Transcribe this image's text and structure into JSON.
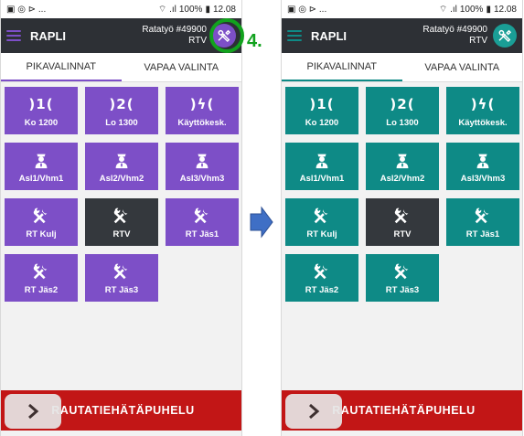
{
  "colors": {
    "purple": "#7d4fc7",
    "teal": "#0e8a86",
    "dark_tile": "#34383d",
    "appbar": "#2d3035",
    "emergency": "#c21616",
    "green_highlight": "#12a21e",
    "arrow_blue": "#3f6fc5",
    "teal_avatar": "#1a9e96"
  },
  "left": {
    "status": {
      "icons": "▣ ◎ ⊳ ...",
      "signal": "⌔ .ıl",
      "battery": "100%",
      "time": "12.08"
    },
    "appbar": {
      "title": "RAPLI",
      "work": "Ratatyö #49900",
      "role": "RTV"
    },
    "tabs": [
      "PIKAVALINNAT",
      "VAPAA VALINTA"
    ],
    "tiles": [
      {
        "label": "Ko 1200",
        "icon": "radio",
        "symbol": ")1("
      },
      {
        "label": "Lo 1300",
        "icon": "radio",
        "symbol": ")2("
      },
      {
        "label": "Käyttökesk.",
        "icon": "radio",
        "symbol": ")ϟ("
      },
      {
        "label": "Asl1/Vhm1",
        "icon": "person-icon"
      },
      {
        "label": "Asl2/Vhm2",
        "icon": "person-icon"
      },
      {
        "label": "Asl3/Vhm3",
        "icon": "person-icon"
      },
      {
        "label": "RT Kulj",
        "icon": "tools-icon"
      },
      {
        "label": "RTV",
        "icon": "tools-icon",
        "selected": true
      },
      {
        "label": "RT Jäs1",
        "icon": "tools-icon"
      },
      {
        "label": "RT Jäs2",
        "icon": "tools-icon"
      },
      {
        "label": "RT Jäs3",
        "icon": "tools-icon"
      }
    ],
    "bottom_label": "RAUTATIEHÄTÄPUHELU"
  },
  "right": {
    "status": {
      "icons": "▣ ◎ ⊳ ...",
      "signal": "⌔ .ıl",
      "battery": "100%",
      "time": "12.08"
    },
    "appbar": {
      "title": "RAPLI",
      "work": "Ratatyö #49900",
      "role": "RTV"
    },
    "tabs": [
      "PIKAVALINNAT",
      "VAPAA VALINTA"
    ],
    "tiles": [
      {
        "label": "Ko 1200",
        "icon": "radio",
        "symbol": ")1("
      },
      {
        "label": "Lo 1300",
        "icon": "radio",
        "symbol": ")2("
      },
      {
        "label": "Käyttökesk.",
        "icon": "radio",
        "symbol": ")ϟ("
      },
      {
        "label": "Asl1/Vhm1",
        "icon": "person-icon"
      },
      {
        "label": "Asl2/Vhm2",
        "icon": "person-icon"
      },
      {
        "label": "Asl3/Vhm3",
        "icon": "person-icon"
      },
      {
        "label": "RT Kulj",
        "icon": "tools-icon"
      },
      {
        "label": "RTV",
        "icon": "tools-icon",
        "selected": true
      },
      {
        "label": "RT Jäs1",
        "icon": "tools-icon"
      },
      {
        "label": "RT Jäs2",
        "icon": "tools-icon"
      },
      {
        "label": "RT Jäs3",
        "icon": "tools-icon"
      }
    ],
    "bottom_label": "RAUTATIEHÄTÄPUHELU"
  },
  "annotation": {
    "step": "4."
  }
}
